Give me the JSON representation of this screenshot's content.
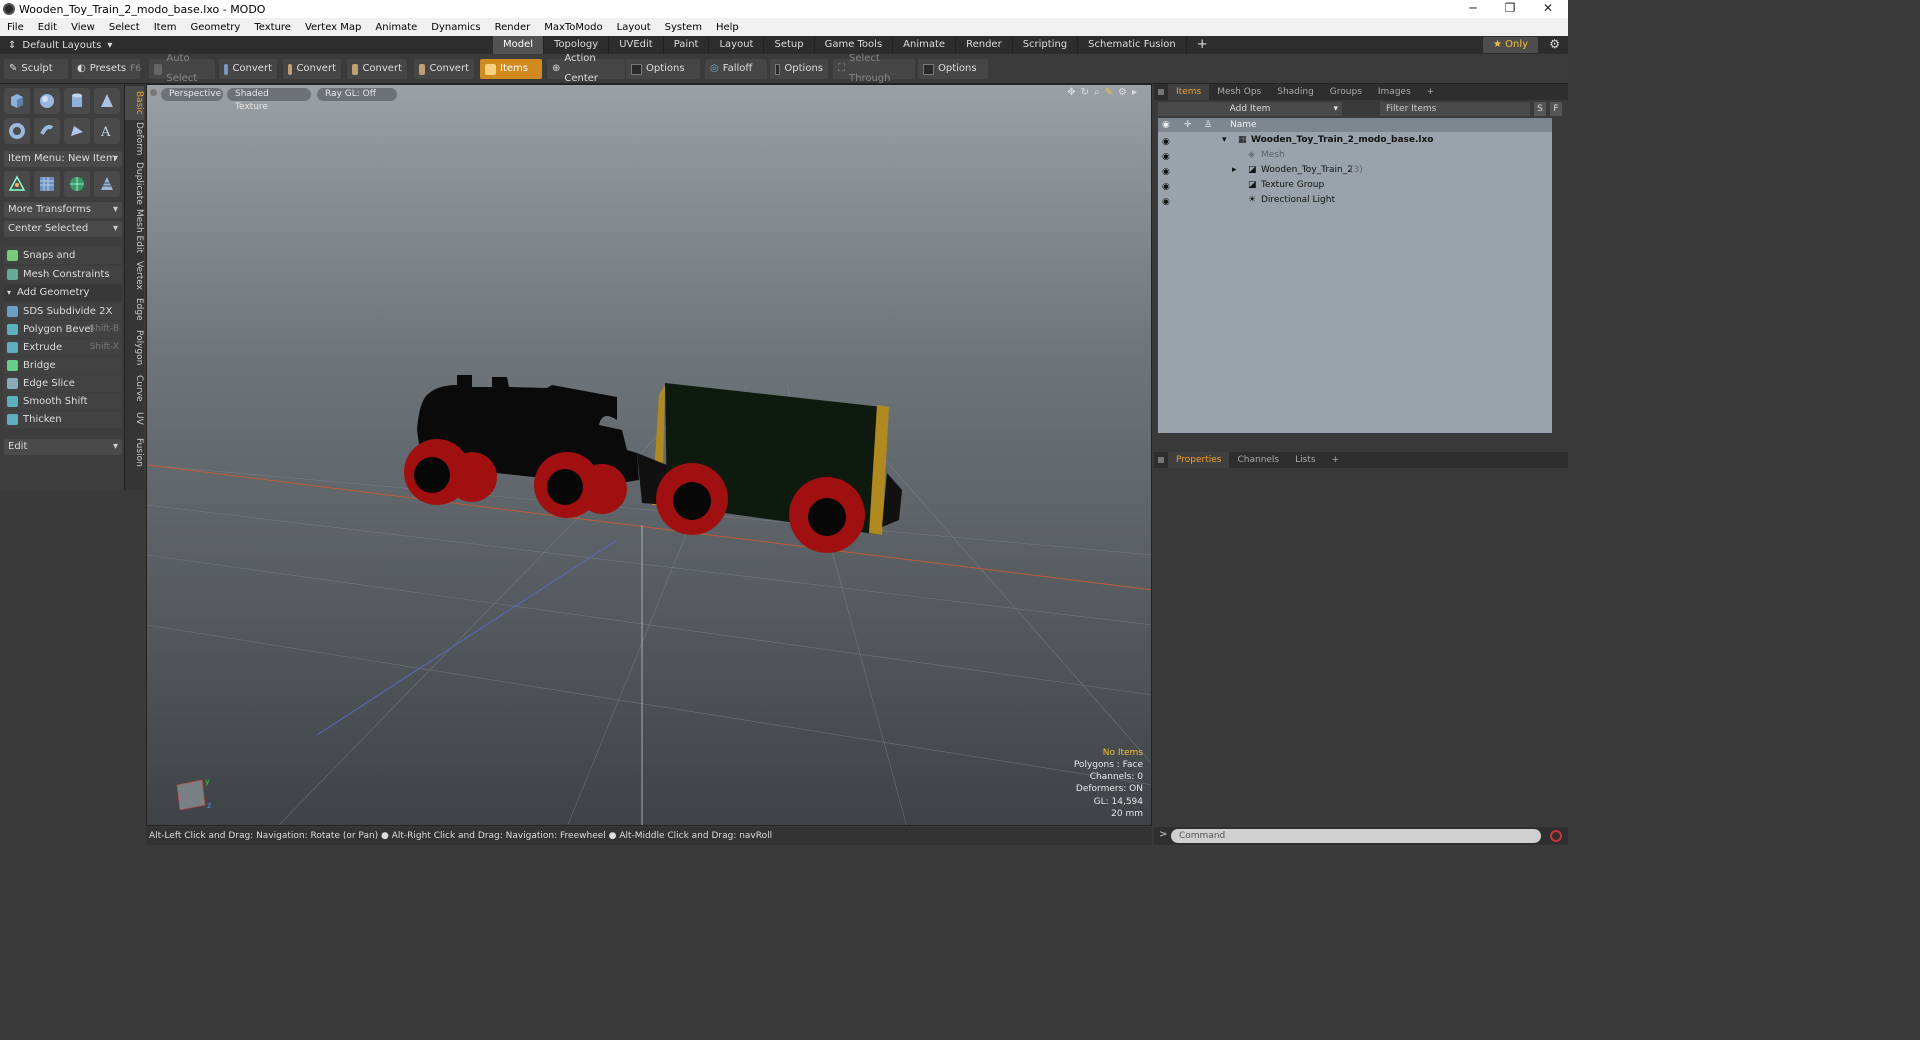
{
  "window": {
    "title": "Wooden_Toy_Train_2_modo_base.lxo - MODO"
  },
  "menu": [
    "File",
    "Edit",
    "View",
    "Select",
    "Item",
    "Geometry",
    "Texture",
    "Vertex Map",
    "Animate",
    "Dynamics",
    "Render",
    "MaxToModo",
    "Layout",
    "System",
    "Help"
  ],
  "layout": {
    "default_layouts": "Default Layouts",
    "only": "Only"
  },
  "mode_tabs": [
    "Model",
    "Topology",
    "UVEdit",
    "Paint",
    "Layout",
    "Setup",
    "Game Tools",
    "Animate",
    "Render",
    "Scripting",
    "Schematic Fusion"
  ],
  "toolbar": {
    "sculpt": "Sculpt",
    "presets": "Presets",
    "presets_key": "F6",
    "auto_select": "Auto Select",
    "convert1": "Convert",
    "convert2": "Convert",
    "convert3": "Convert",
    "convert4": "Convert",
    "items": "Items",
    "action_center": "Action Center",
    "options1": "Options",
    "falloff": "Falloff",
    "options2": "Options",
    "select_through": "Select Through",
    "options3": "Options"
  },
  "left_panel": {
    "item_menu": "Item Menu: New Item",
    "more_transforms": "More Transforms",
    "center_selected": "Center Selected",
    "snaps": "Snaps and Precision",
    "mesh_constraints": "Mesh Constraints",
    "add_geometry": "Add Geometry",
    "tools": [
      {
        "label": "SDS Subdivide 2X",
        "key": ""
      },
      {
        "label": "Polygon Bevel",
        "key": "Shift-B"
      },
      {
        "label": "Extrude",
        "key": "Shift-X"
      },
      {
        "label": "Bridge",
        "key": ""
      },
      {
        "label": "Edge Slice",
        "key": ""
      },
      {
        "label": "Smooth Shift",
        "key": ""
      },
      {
        "label": "Thicken",
        "key": ""
      }
    ],
    "edit": "Edit",
    "vtabs": [
      "Basic",
      "Deform",
      "Duplicate",
      "Mesh Edit",
      "Vertex",
      "Edge",
      "Polygon",
      "Curve",
      "UV",
      "Fusion"
    ]
  },
  "viewport": {
    "perspective": "Perspective",
    "shading": "Shaded Texture",
    "raygl": "Ray GL: Off",
    "info": {
      "items": "No Items",
      "polygons": "Polygons : Face",
      "channels": "Channels: 0",
      "deformers": "Deformers: ON",
      "gl": "GL: 14,594",
      "size": "20 mm"
    }
  },
  "status": "Alt-Left Click and Drag: Navigation: Rotate (or Pan) ● Alt-Right Click and Drag: Navigation: Freewheel ● Alt-Middle Click and Drag: navRoll",
  "right_panel": {
    "tabs": [
      "Items",
      "Mesh Ops",
      "Shading",
      "Groups",
      "Images"
    ],
    "add_item": "Add Item",
    "filter_items": "Filter Items",
    "filter_s": "S",
    "filter_f": "F",
    "name_col": "Name",
    "tree": [
      {
        "label": "Wooden_Toy_Train_2_modo_base.lxo",
        "count": "",
        "indent": 0,
        "bold": true
      },
      {
        "label": "Mesh",
        "count": "",
        "indent": 1,
        "dim": true
      },
      {
        "label": "Wooden_Toy_Train_2",
        "count": "(3)",
        "indent": 1
      },
      {
        "label": "Texture Group",
        "count": "",
        "indent": 1
      },
      {
        "label": "Directional Light",
        "count": "",
        "indent": 1
      }
    ],
    "bottom_tabs": [
      "Properties",
      "Channels",
      "Lists"
    ],
    "command_placeholder": "Command"
  }
}
